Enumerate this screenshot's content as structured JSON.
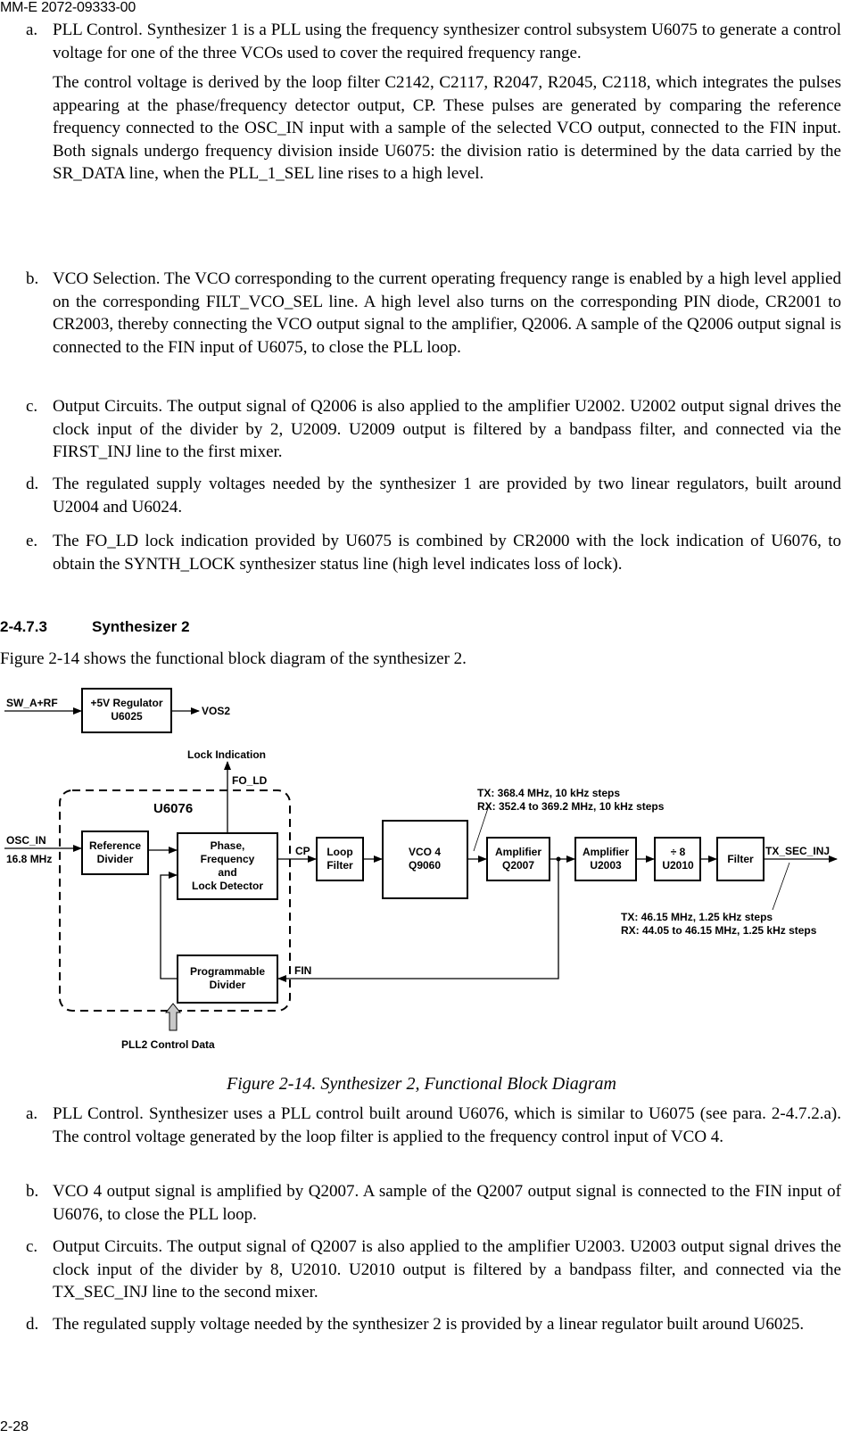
{
  "page": {
    "doc_number": "MM-E 2072-09333-00",
    "page_number": "2-28"
  },
  "section1_items": [
    {
      "label": "a.",
      "paragraphs": [
        "PLL Control. Synthesizer 1 is a PLL using the frequency synthesizer control subsystem U6075 to generate a control voltage for one of the three VCOs used to cover the required frequency range.",
        "The control voltage is derived by the loop filter C2142, C2117, R2047, R2045, C2118, which integrates the pulses appearing at the phase/frequency detector output, CP. These pulses are generated by comparing the reference frequency connected to the OSC_IN input with a sample of the selected VCO output, connected to the FIN input. Both signals undergo frequency division inside U6075: the division ratio is determined by the data carried by the SR_DATA line, when the PLL_1_SEL line rises to a high level."
      ]
    },
    {
      "label": "b.",
      "paragraphs": [
        "VCO Selection. The VCO corresponding to the current operating frequency range is enabled by a high level applied on the corresponding FILT_VCO_SEL line. A high level also turns on the corresponding PIN diode, CR2001 to CR2003, thereby connecting the VCO output signal to the amplifier, Q2006. A sample of the Q2006 output signal is connected to the FIN input of U6075, to close the PLL loop."
      ]
    },
    {
      "label": "c.",
      "paragraphs": [
        "Output Circuits. The output signal of Q2006 is also applied to the amplifier U2002. U2002 output signal drives the clock input of the divider by 2, U2009. U2009 output is filtered by a bandpass filter, and connected via the FIRST_INJ line to the first mixer."
      ]
    },
    {
      "label": "d.",
      "paragraphs": [
        "The regulated supply voltages needed by the synthesizer 1 are provided by two linear regulators, built around U2004 and U6024."
      ]
    },
    {
      "label": "e.",
      "paragraphs": [
        "The FO_LD lock indication provided by U6075 is combined by CR2000 with the lock indication of U6076, to obtain the SYNTH_LOCK synthesizer status line (high level indicates loss of lock)."
      ]
    }
  ],
  "section2": {
    "number": "2-4.7.3",
    "title": "Synthesizer 2",
    "intro": "Figure 2-14 shows the functional block diagram of the synthesizer 2."
  },
  "diagram": {
    "regulator": {
      "input": "SW_A+RF",
      "line1": "+5V Regulator",
      "line2": "U6025",
      "output": "VOS2"
    },
    "chip_label": "U6076",
    "lock_indication": "Lock Indication",
    "fo_ld": "FO_LD",
    "osc_in": "OSC_IN",
    "osc_freq": "16.8 MHz",
    "ref_divider": [
      "Reference",
      "Divider"
    ],
    "detector": [
      "Phase,",
      "Frequency",
      "and",
      "Lock Detector"
    ],
    "prog_divider": [
      "Programmable",
      "Divider"
    ],
    "cp": "CP",
    "fin": "FIN",
    "loop_filter": [
      "Loop",
      "Filter"
    ],
    "vco": [
      "VCO 4",
      "Q9060"
    ],
    "amp1": [
      "Amplifier",
      "Q2007"
    ],
    "amp2": [
      "Amplifier",
      "U2003"
    ],
    "divider8": [
      "÷ 8",
      "U2010"
    ],
    "filter": "Filter",
    "output": "TX_SEC_INJ",
    "vco_note": [
      "TX: 368.4 MHz, 10 kHz steps",
      "RX: 352.4 to 369.2 MHz, 10 kHz steps"
    ],
    "out_note": [
      "TX: 46.15 MHz, 1.25 kHz steps",
      "RX: 44.05 to 46.15 MHz, 1.25 kHz steps"
    ],
    "control_data": "PLL2 Control Data"
  },
  "figure_caption": "Figure 2-14. Synthesizer 2, Functional Block Diagram",
  "section2_items": [
    {
      "label": "a.",
      "text": "PLL Control. Synthesizer uses a PLL control built around U6076, which is similar to U6075 (see para. 2-4.7.2.a). The control voltage generated by the loop filter is applied to the frequency control input of VCO 4."
    },
    {
      "label": "b.",
      "text": "VCO 4 output signal is amplified by Q2007. A sample of the Q2007 output signal is connected to the FIN input of U6076, to close the PLL loop."
    },
    {
      "label": "c.",
      "text": "Output Circuits. The output signal of Q2007 is also applied to the amplifier U2003. U2003 output signal drives the clock input of the divider by 8, U2010. U2010 output is filtered by a bandpass filter, and connected via the TX_SEC_INJ line to the second mixer."
    },
    {
      "label": "d.",
      "text": "The regulated supply voltage needed by the synthesizer 2 is provided by a linear regulator built around U6025."
    }
  ]
}
